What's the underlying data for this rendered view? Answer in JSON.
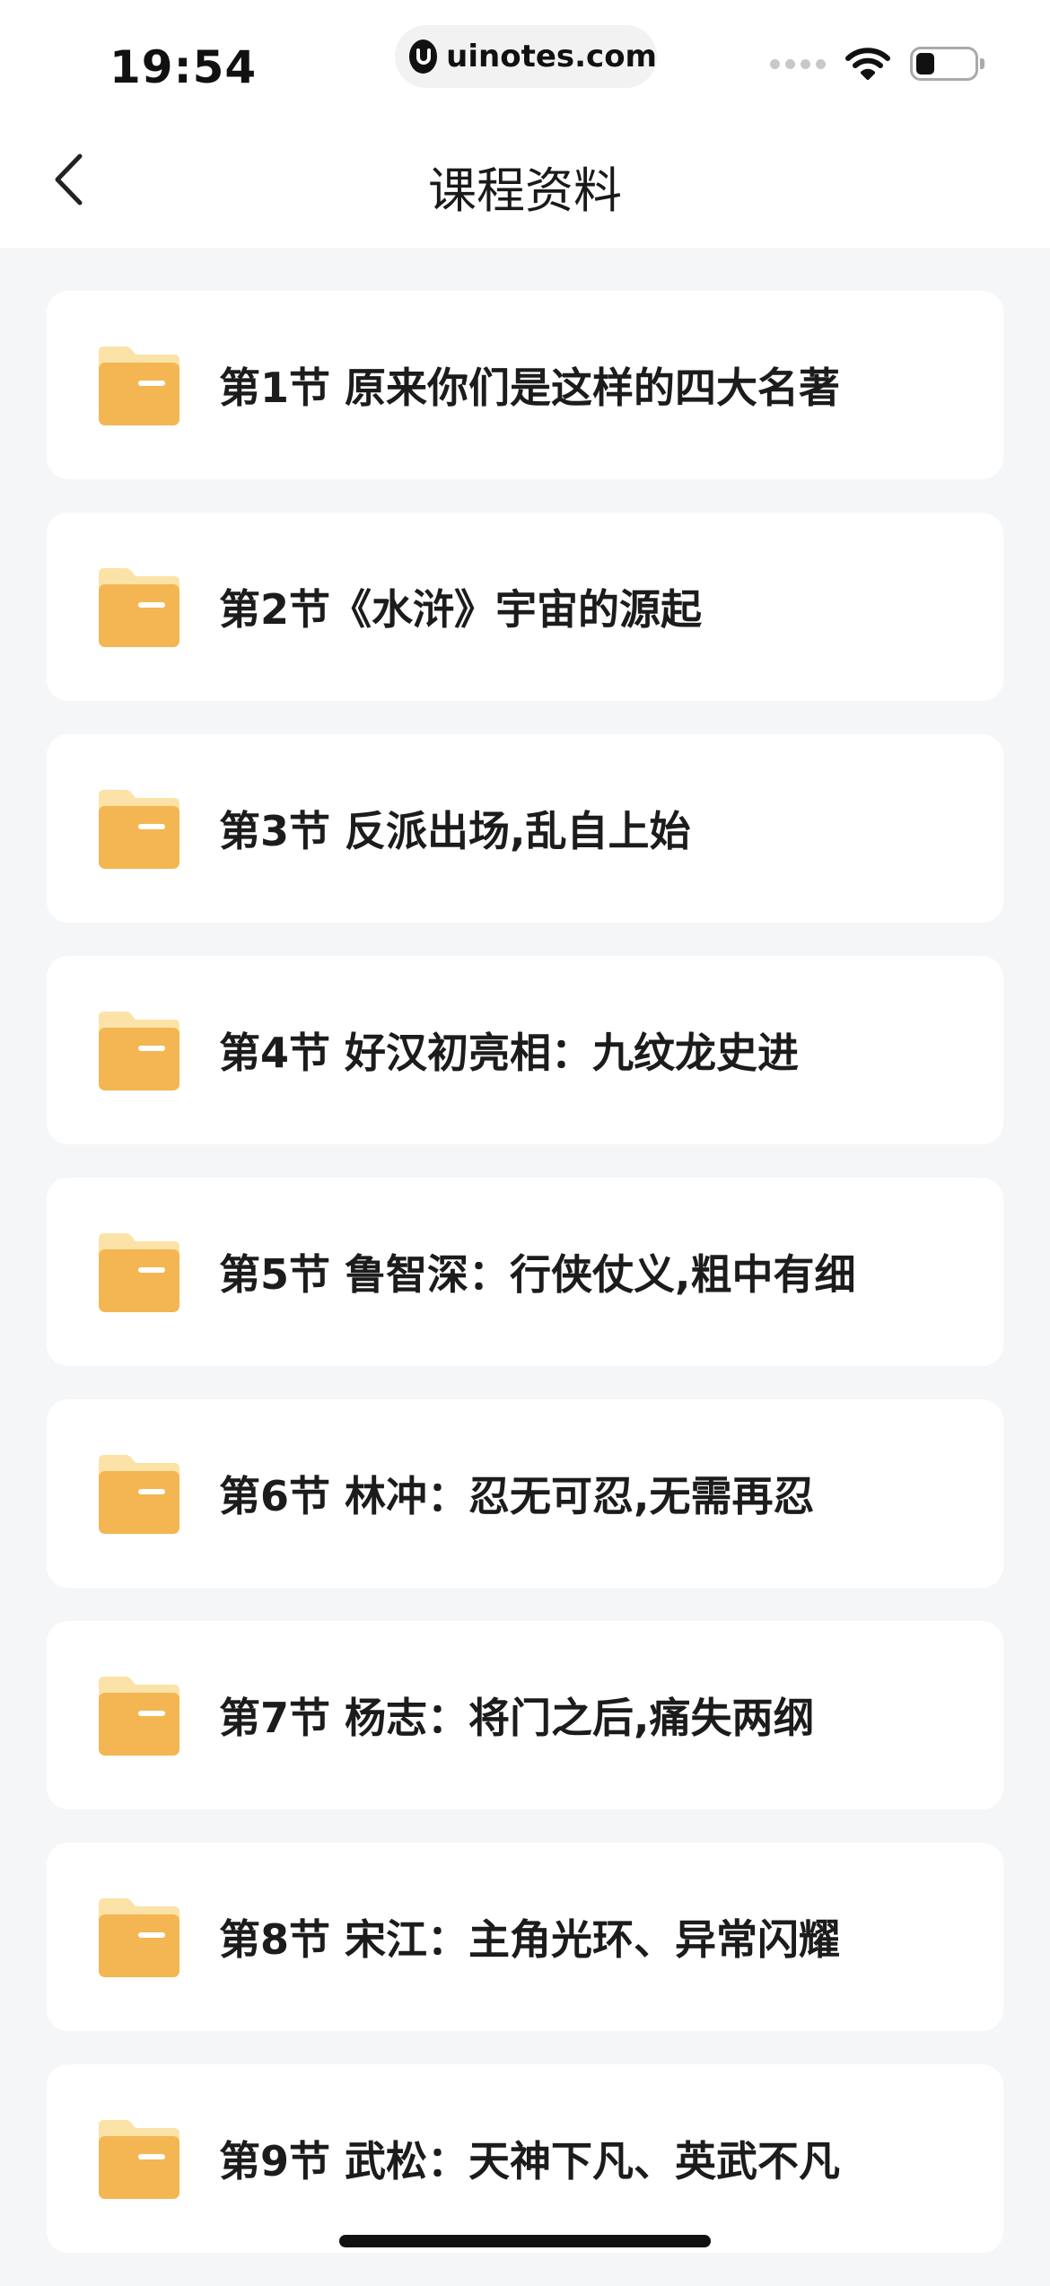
{
  "status_bar": {
    "time": "19:54",
    "url": "uinotes.com"
  },
  "nav": {
    "title": "课程资料",
    "back_icon": "chevron-left-icon"
  },
  "colors": {
    "folder_back": "#fbe3a8",
    "folder_front": "#f3b652",
    "background": "#f5f6f8",
    "card": "#ffffff"
  },
  "lessons": [
    {
      "label": "第1节 原来你们是这样的四大名著"
    },
    {
      "label": "第2节《水浒》宇宙的源起"
    },
    {
      "label": "第3节 反派出场,乱自上始"
    },
    {
      "label": "第4节 好汉初亮相：九纹龙史进"
    },
    {
      "label": "第5节 鲁智深：行侠仗义,粗中有细"
    },
    {
      "label": "第6节 林冲：忍无可忍,无需再忍"
    },
    {
      "label": "第7节 杨志：将门之后,痛失两纲"
    },
    {
      "label": "第8节 宋江：主角光环、异常闪耀"
    },
    {
      "label": "第9节 武松：天神下凡、英武不凡"
    }
  ]
}
